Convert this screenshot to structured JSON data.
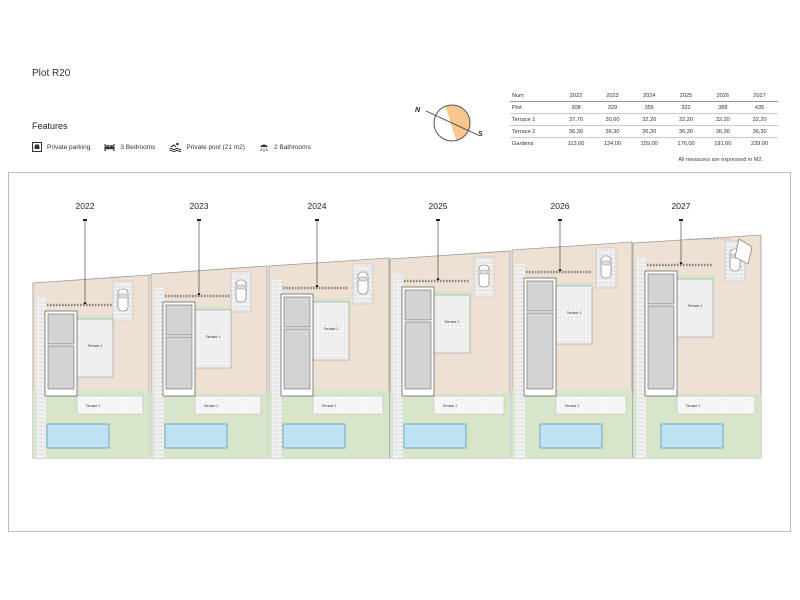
{
  "plot_title": "Plot R20",
  "features": {
    "title": "Features",
    "items": [
      {
        "icon": "parking-icon",
        "label": "Private parking"
      },
      {
        "icon": "bed-icon",
        "label": "3 Bedrooms"
      },
      {
        "icon": "pool-icon",
        "label": "Private pool (21 m2)"
      },
      {
        "icon": "shower-icon",
        "label": "2 Bathrooms"
      }
    ]
  },
  "compass": {
    "north": "N",
    "south": "S"
  },
  "table": {
    "headers": [
      "Num",
      "2022",
      "2023",
      "2024",
      "2025",
      "2026",
      "2027"
    ],
    "rows": [
      [
        "Plot",
        "308",
        "329",
        "356",
        "322",
        "388",
        "435"
      ],
      [
        "Terrace 1",
        "37,70",
        "30,60",
        "32,20",
        "32,20",
        "32,20",
        "32,20"
      ],
      [
        "Terrace 2",
        "36,30",
        "36,30",
        "36,30",
        "36,30",
        "36,30",
        "36,30"
      ],
      [
        "Gardens",
        "113,00",
        "134,00",
        "159,00",
        "176,00",
        "191,00",
        "239,00"
      ]
    ]
  },
  "note": "All measures are expressed in M2.",
  "plots": [
    {
      "label": "2022",
      "t1": "Terrace 1",
      "t2": "Terrace 2"
    },
    {
      "label": "2023",
      "t1": "Terrace 1",
      "t2": "Terrace 2"
    },
    {
      "label": "2024",
      "t1": "Terrace 1",
      "t2": "Terrace 2"
    },
    {
      "label": "2025",
      "t1": "Terrace 1",
      "t2": "Terrace 2"
    },
    {
      "label": "2026",
      "t1": "Terrace 1",
      "t2": "Terrace 2"
    },
    {
      "label": "2027",
      "t1": "Terrace 1",
      "t2": "Terrace 2"
    }
  ],
  "colors": {
    "path": "#efe0d4",
    "garden": "#d7e6cb",
    "pool": "#bfe3f2",
    "pool_edge": "#6fa9c6",
    "house": "#d3d3d3",
    "compass_half": "#f6c88f"
  }
}
